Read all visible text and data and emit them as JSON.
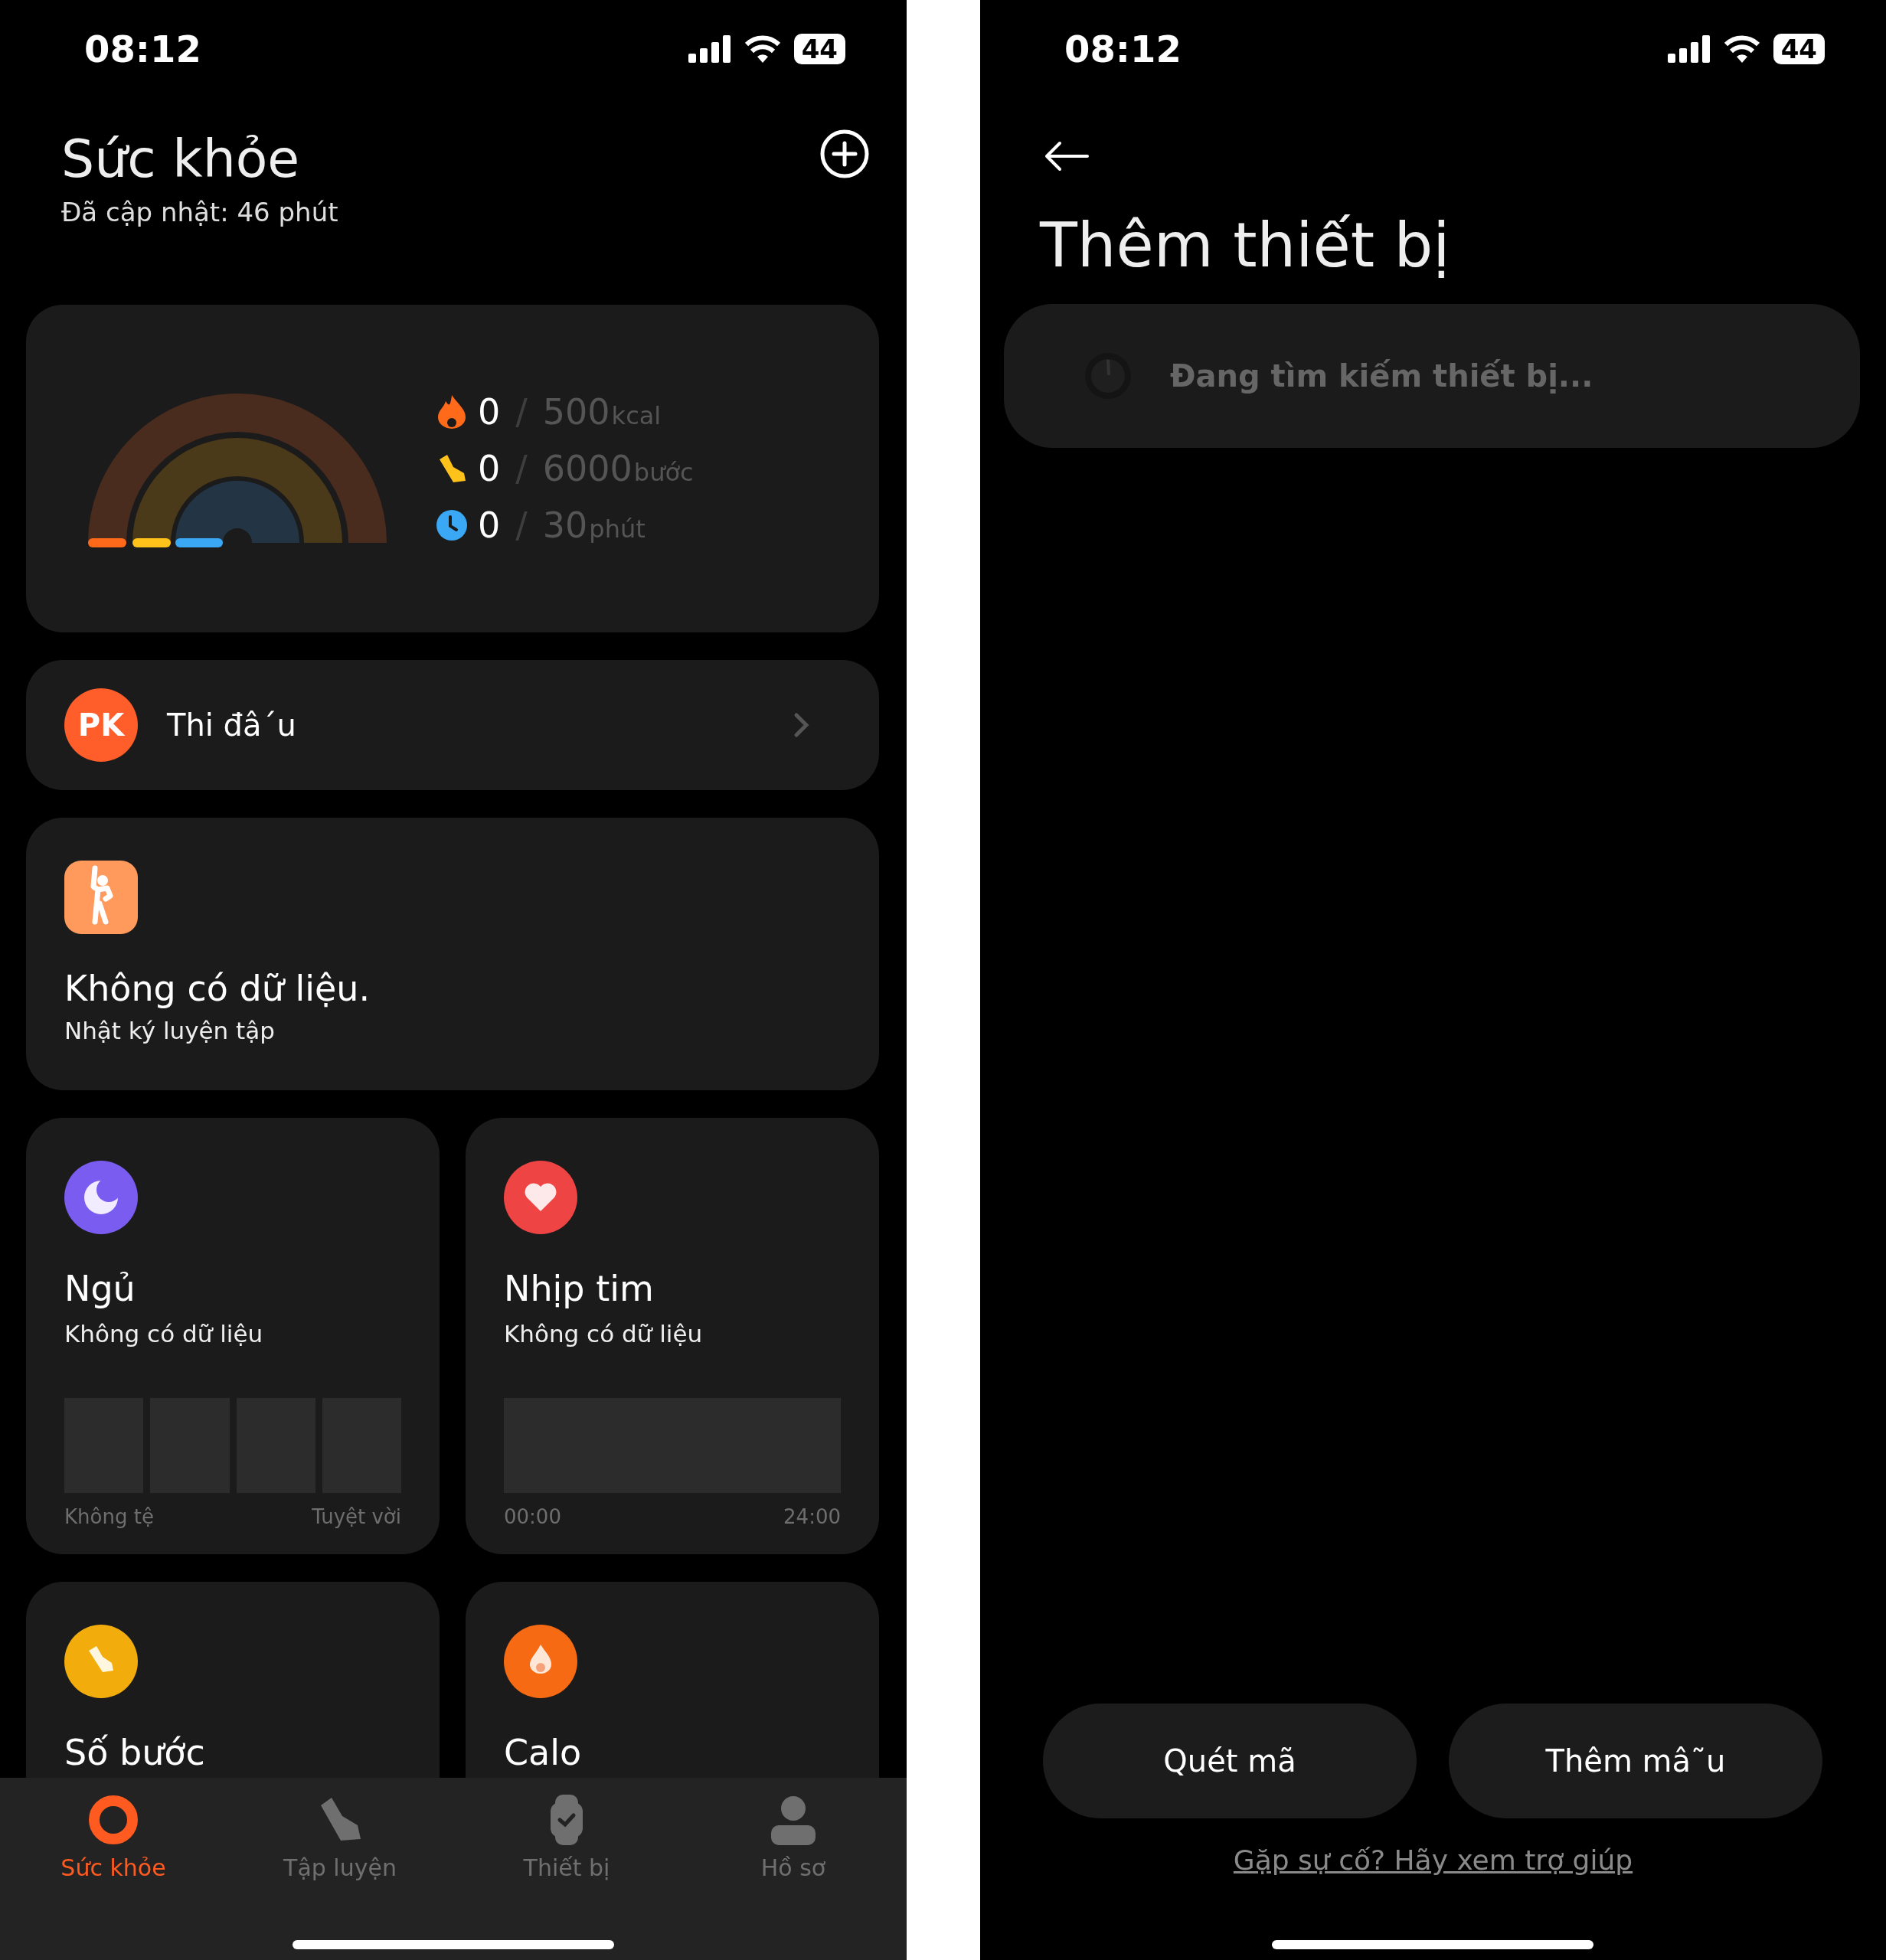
{
  "home": {
    "status_bar": {
      "time": "08:12",
      "battery": "44"
    },
    "title": "Sức khỏe",
    "updated": "Đã cập nhật: 46 phút",
    "activity": [
      {
        "kind": "calories",
        "value": "0",
        "separator": "/",
        "goal": "500",
        "unit": "kcal",
        "color": "#ff6a1a"
      },
      {
        "kind": "steps",
        "value": "0",
        "separator": "/",
        "goal": "6000",
        "unit": "bước",
        "color": "#ffc21a"
      },
      {
        "kind": "time",
        "value": "0",
        "separator": "/",
        "goal": "30",
        "unit": "phút",
        "color": "#3aa8f5"
      }
    ],
    "competition": {
      "badge": "PK",
      "label": "Thi đâ´u"
    },
    "workout": {
      "title": "Không có dữ liệu.",
      "subtitle": "Nhật ký luyện tập"
    },
    "cards": [
      {
        "kind": "sleep",
        "title": "Ngủ",
        "subtitle": "Không có dữ liệu",
        "axis": [
          "Không tệ",
          "Tuyệt vời"
        ]
      },
      {
        "kind": "heart",
        "title": "Nhịp tim",
        "subtitle": "Không có dữ liệu",
        "axis": [
          "00:00",
          "24:00"
        ]
      },
      {
        "kind": "steps",
        "title": "Số bước"
      },
      {
        "kind": "calories",
        "title": "Calo"
      }
    ],
    "tabs": [
      {
        "kind": "health",
        "label": "Sức khỏe",
        "selected": true
      },
      {
        "kind": "workout",
        "label": "Tập luyện",
        "selected": false
      },
      {
        "kind": "device",
        "label": "Thiết bị",
        "selected": false
      },
      {
        "kind": "profile",
        "label": "Hồ sơ",
        "selected": false
      }
    ]
  },
  "add_device": {
    "status_bar": {
      "time": "08:12",
      "battery": "44"
    },
    "title": "Thêm thiết bị",
    "searching": "Đang tìm kiếm thiết bị...",
    "buttons": [
      "Quét mã",
      "Thêm mâ˜u"
    ],
    "help_link": "Gặp sự cố? Hãy xem trợ giúp"
  }
}
